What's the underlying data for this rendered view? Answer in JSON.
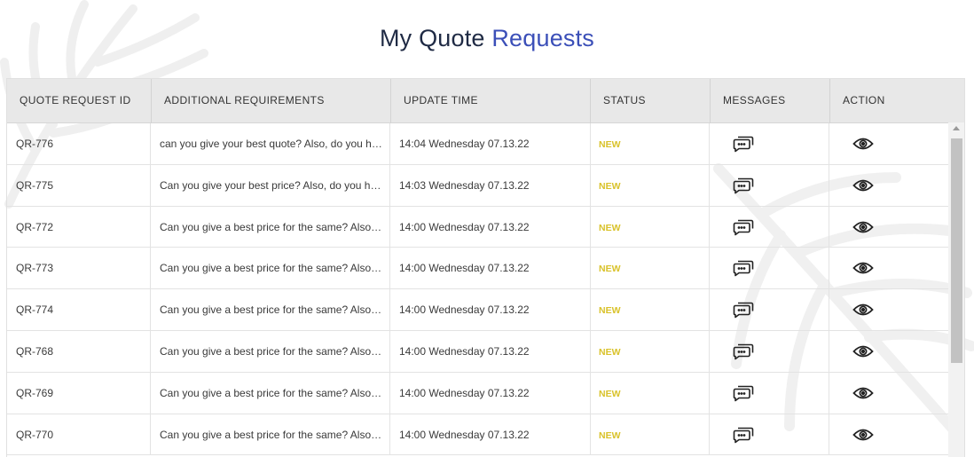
{
  "page": {
    "title_part1": "My Quote",
    "title_part2": "Requests",
    "accent_color": "#3b4fb8",
    "status_color": "#d9c22a"
  },
  "table": {
    "columns": [
      "QUOTE REQUEST ID",
      "ADDITIONAL REQUIREMENTS",
      "UPDATE TIME",
      "STATUS",
      "MESSAGES",
      "ACTION"
    ],
    "rows": [
      {
        "id": "QR-776",
        "requirements": "can you give your best quote? Also, do you have any other options?",
        "time": "14:04 Wednesday 07.13.22",
        "status": "NEW",
        "messages_icon": "chat-icon",
        "action_icon": "eye-icon"
      },
      {
        "id": "QR-775",
        "requirements": "Can you give your best price? Also, do you have any other options?",
        "time": "14:03 Wednesday 07.13.22",
        "status": "NEW",
        "messages_icon": "chat-icon",
        "action_icon": "eye-icon"
      },
      {
        "id": "QR-772",
        "requirements": "Can you give a best price for the same? Also, do you have any other options?",
        "time": "14:00 Wednesday 07.13.22",
        "status": "NEW",
        "messages_icon": "chat-icon",
        "action_icon": "eye-icon"
      },
      {
        "id": "QR-773",
        "requirements": "Can you give a best price for the same? Also, do you have any other options?",
        "time": "14:00 Wednesday 07.13.22",
        "status": "NEW",
        "messages_icon": "chat-icon",
        "action_icon": "eye-icon"
      },
      {
        "id": "QR-774",
        "requirements": "Can you give a best price for the same? Also, do you have any other options?",
        "time": "14:00 Wednesday 07.13.22",
        "status": "NEW",
        "messages_icon": "chat-icon",
        "action_icon": "eye-icon"
      },
      {
        "id": "QR-768",
        "requirements": "Can you give a best price for the same? Also, do you have any other options?",
        "time": "14:00 Wednesday 07.13.22",
        "status": "NEW",
        "messages_icon": "chat-icon",
        "action_icon": "eye-icon"
      },
      {
        "id": "QR-769",
        "requirements": "Can you give a best price for the same? Also, do you have any other options?",
        "time": "14:00 Wednesday 07.13.22",
        "status": "NEW",
        "messages_icon": "chat-icon",
        "action_icon": "eye-icon"
      },
      {
        "id": "QR-770",
        "requirements": "Can you give a best price for the same? Also, do you have any other options?",
        "time": "14:00 Wednesday 07.13.22",
        "status": "NEW",
        "messages_icon": "chat-icon",
        "action_icon": "eye-icon"
      }
    ]
  }
}
